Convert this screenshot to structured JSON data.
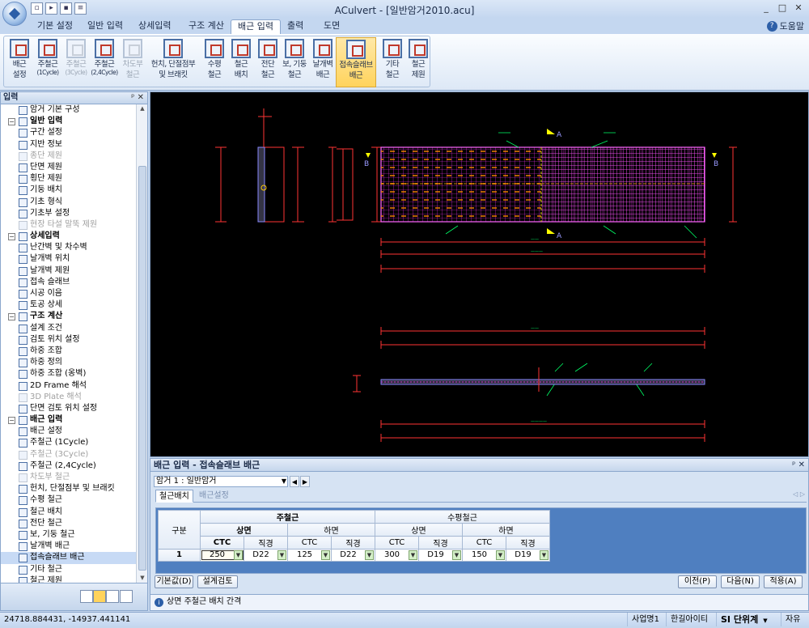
{
  "window": {
    "title": "ACulvert - [일반암거2010.acu]",
    "qat_icons": [
      "new-icon",
      "open-icon",
      "save-icon",
      "print-icon"
    ],
    "controls": {
      "minimize": "_",
      "restore": "□",
      "close": "✕"
    }
  },
  "ribbon_tabs": [
    {
      "label": "기본 설정"
    },
    {
      "label": "일반 입력"
    },
    {
      "label": "상세입력"
    },
    {
      "label": "구조 계산"
    },
    {
      "label": "배근 입력"
    },
    {
      "label": "출력"
    },
    {
      "label": "도면"
    }
  ],
  "help_label": "도움말",
  "ribbon_buttons": [
    {
      "l1": "배근",
      "l2": "설정",
      "sub": ""
    },
    {
      "l1": "주철근",
      "l2": "",
      "sub": "(1Cycle)"
    },
    {
      "l1": "주철근",
      "l2": "",
      "sub": "(3Cycle)"
    },
    {
      "l1": "주철근",
      "l2": "",
      "sub": "(2,4Cycle)"
    },
    {
      "l1": "차도부",
      "l2": "철근",
      "sub": ""
    },
    {
      "l1": "헌치, 단절점부",
      "l2": "및 브래킷",
      "sub": ""
    },
    {
      "l1": "수평",
      "l2": "철근",
      "sub": ""
    },
    {
      "l1": "철근",
      "l2": "배치",
      "sub": ""
    },
    {
      "l1": "전단",
      "l2": "철근",
      "sub": ""
    },
    {
      "l1": "보, 기둥",
      "l2": "철근",
      "sub": ""
    },
    {
      "l1": "날개벽",
      "l2": "배근",
      "sub": ""
    },
    {
      "l1": "접속슬래브",
      "l2": "배근",
      "sub": ""
    },
    {
      "l1": "기타",
      "l2": "철근",
      "sub": ""
    },
    {
      "l1": "철근",
      "l2": "제원",
      "sub": ""
    }
  ],
  "left_panel": {
    "title": "입력",
    "tree": [
      {
        "label": "암거 기본 구성",
        "type": "it"
      },
      {
        "label": "일반 입력",
        "type": "cat"
      },
      {
        "label": "구간 설정",
        "type": "it"
      },
      {
        "label": "지반 정보",
        "type": "it"
      },
      {
        "label": "종단 제원",
        "type": "it",
        "dis": true
      },
      {
        "label": "단면 제원",
        "type": "it"
      },
      {
        "label": "횡단 제원",
        "type": "it"
      },
      {
        "label": "기둥 배치",
        "type": "it"
      },
      {
        "label": "기초 형식",
        "type": "it"
      },
      {
        "label": "기초부 설정",
        "type": "it"
      },
      {
        "label": "현장 타설 말뚝 제원",
        "type": "it",
        "dis": true
      },
      {
        "label": "상세입력",
        "type": "cat"
      },
      {
        "label": "난간벽 및 차수벽",
        "type": "it"
      },
      {
        "label": "날개벽 위치",
        "type": "it"
      },
      {
        "label": "날개벽 제원",
        "type": "it"
      },
      {
        "label": "접속 슬래브",
        "type": "it"
      },
      {
        "label": "시공 이음",
        "type": "it"
      },
      {
        "label": "토공 상세",
        "type": "it"
      },
      {
        "label": "구조 계산",
        "type": "cat"
      },
      {
        "label": "설계 조건",
        "type": "it"
      },
      {
        "label": "검토 위치 설정",
        "type": "it"
      },
      {
        "label": "하중 조합",
        "type": "it"
      },
      {
        "label": "하중 정의",
        "type": "it"
      },
      {
        "label": "하중 조합 (옹벽)",
        "type": "it"
      },
      {
        "label": "2D Frame 해석",
        "type": "it"
      },
      {
        "label": "3D Plate 해석",
        "type": "it",
        "dis": true
      },
      {
        "label": "단면 검토 위치 설정",
        "type": "it"
      },
      {
        "label": "배근 입력",
        "type": "cat"
      },
      {
        "label": "배근 설정",
        "type": "it"
      },
      {
        "label": "주철근 (1Cycle)",
        "type": "it"
      },
      {
        "label": "주철근 (3Cycle)",
        "type": "it",
        "dis": true
      },
      {
        "label": "주철근 (2,4Cycle)",
        "type": "it"
      },
      {
        "label": "차도부 철근",
        "type": "it",
        "dis": true
      },
      {
        "label": "헌치, 단절점부 및 브래킷",
        "type": "it"
      },
      {
        "label": "수평 철근",
        "type": "it"
      },
      {
        "label": "철근 배치",
        "type": "it"
      },
      {
        "label": "전단 철근",
        "type": "it"
      },
      {
        "label": "보, 기둥 철근",
        "type": "it"
      },
      {
        "label": "날개벽 배근",
        "type": "it"
      },
      {
        "label": "접속슬래브 배근",
        "type": "it",
        "hl": true
      },
      {
        "label": "기타 철근",
        "type": "it"
      },
      {
        "label": "철근 제원",
        "type": "it"
      }
    ]
  },
  "cad_labels": {
    "section_a": "A",
    "section_b": "B"
  },
  "bottom_panel": {
    "title": "배근 입력 - 접속슬래브 배근",
    "combo_value": "암거 1 : 일반암거",
    "tabs": [
      "철근배치",
      "배근설정"
    ],
    "table": {
      "col_group": "구분",
      "main_bar": "주철근",
      "horiz_bar": "수평철근",
      "top": "상면",
      "bottom": "하면",
      "ctc": "CTC",
      "dia": "직경",
      "row_label": "1",
      "values": [
        "250",
        "D22",
        "125",
        "D22",
        "300",
        "D19",
        "150",
        "D19"
      ]
    },
    "buttons": {
      "default": "기본값(D)",
      "check": "설계검토",
      "prev": "이전(P)",
      "next": "다음(N)",
      "apply": "적용(A)"
    },
    "hint": "상면 주철근 배치 간격"
  },
  "statusbar": {
    "coords": "24718.884431,  -14937.441141",
    "company": "사업명1",
    "engineer": "한길아이티",
    "units_si": "SI",
    "units": "단위계",
    "mode": "자유"
  }
}
